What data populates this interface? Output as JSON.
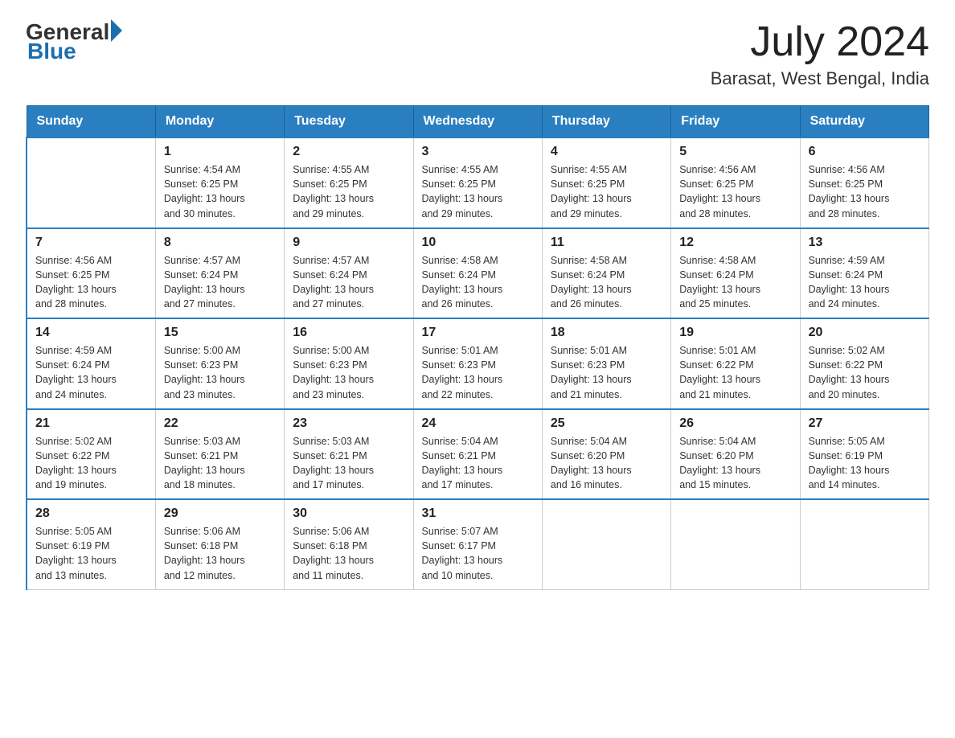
{
  "logo": {
    "general": "General",
    "blue": "Blue",
    "triangle": "▶"
  },
  "title": {
    "month_year": "July 2024",
    "location": "Barasat, West Bengal, India"
  },
  "weekdays": [
    "Sunday",
    "Monday",
    "Tuesday",
    "Wednesday",
    "Thursday",
    "Friday",
    "Saturday"
  ],
  "weeks": [
    [
      {
        "day": "",
        "info": ""
      },
      {
        "day": "1",
        "info": "Sunrise: 4:54 AM\nSunset: 6:25 PM\nDaylight: 13 hours\nand 30 minutes."
      },
      {
        "day": "2",
        "info": "Sunrise: 4:55 AM\nSunset: 6:25 PM\nDaylight: 13 hours\nand 29 minutes."
      },
      {
        "day": "3",
        "info": "Sunrise: 4:55 AM\nSunset: 6:25 PM\nDaylight: 13 hours\nand 29 minutes."
      },
      {
        "day": "4",
        "info": "Sunrise: 4:55 AM\nSunset: 6:25 PM\nDaylight: 13 hours\nand 29 minutes."
      },
      {
        "day": "5",
        "info": "Sunrise: 4:56 AM\nSunset: 6:25 PM\nDaylight: 13 hours\nand 28 minutes."
      },
      {
        "day": "6",
        "info": "Sunrise: 4:56 AM\nSunset: 6:25 PM\nDaylight: 13 hours\nand 28 minutes."
      }
    ],
    [
      {
        "day": "7",
        "info": "Sunrise: 4:56 AM\nSunset: 6:25 PM\nDaylight: 13 hours\nand 28 minutes."
      },
      {
        "day": "8",
        "info": "Sunrise: 4:57 AM\nSunset: 6:24 PM\nDaylight: 13 hours\nand 27 minutes."
      },
      {
        "day": "9",
        "info": "Sunrise: 4:57 AM\nSunset: 6:24 PM\nDaylight: 13 hours\nand 27 minutes."
      },
      {
        "day": "10",
        "info": "Sunrise: 4:58 AM\nSunset: 6:24 PM\nDaylight: 13 hours\nand 26 minutes."
      },
      {
        "day": "11",
        "info": "Sunrise: 4:58 AM\nSunset: 6:24 PM\nDaylight: 13 hours\nand 26 minutes."
      },
      {
        "day": "12",
        "info": "Sunrise: 4:58 AM\nSunset: 6:24 PM\nDaylight: 13 hours\nand 25 minutes."
      },
      {
        "day": "13",
        "info": "Sunrise: 4:59 AM\nSunset: 6:24 PM\nDaylight: 13 hours\nand 24 minutes."
      }
    ],
    [
      {
        "day": "14",
        "info": "Sunrise: 4:59 AM\nSunset: 6:24 PM\nDaylight: 13 hours\nand 24 minutes."
      },
      {
        "day": "15",
        "info": "Sunrise: 5:00 AM\nSunset: 6:23 PM\nDaylight: 13 hours\nand 23 minutes."
      },
      {
        "day": "16",
        "info": "Sunrise: 5:00 AM\nSunset: 6:23 PM\nDaylight: 13 hours\nand 23 minutes."
      },
      {
        "day": "17",
        "info": "Sunrise: 5:01 AM\nSunset: 6:23 PM\nDaylight: 13 hours\nand 22 minutes."
      },
      {
        "day": "18",
        "info": "Sunrise: 5:01 AM\nSunset: 6:23 PM\nDaylight: 13 hours\nand 21 minutes."
      },
      {
        "day": "19",
        "info": "Sunrise: 5:01 AM\nSunset: 6:22 PM\nDaylight: 13 hours\nand 21 minutes."
      },
      {
        "day": "20",
        "info": "Sunrise: 5:02 AM\nSunset: 6:22 PM\nDaylight: 13 hours\nand 20 minutes."
      }
    ],
    [
      {
        "day": "21",
        "info": "Sunrise: 5:02 AM\nSunset: 6:22 PM\nDaylight: 13 hours\nand 19 minutes."
      },
      {
        "day": "22",
        "info": "Sunrise: 5:03 AM\nSunset: 6:21 PM\nDaylight: 13 hours\nand 18 minutes."
      },
      {
        "day": "23",
        "info": "Sunrise: 5:03 AM\nSunset: 6:21 PM\nDaylight: 13 hours\nand 17 minutes."
      },
      {
        "day": "24",
        "info": "Sunrise: 5:04 AM\nSunset: 6:21 PM\nDaylight: 13 hours\nand 17 minutes."
      },
      {
        "day": "25",
        "info": "Sunrise: 5:04 AM\nSunset: 6:20 PM\nDaylight: 13 hours\nand 16 minutes."
      },
      {
        "day": "26",
        "info": "Sunrise: 5:04 AM\nSunset: 6:20 PM\nDaylight: 13 hours\nand 15 minutes."
      },
      {
        "day": "27",
        "info": "Sunrise: 5:05 AM\nSunset: 6:19 PM\nDaylight: 13 hours\nand 14 minutes."
      }
    ],
    [
      {
        "day": "28",
        "info": "Sunrise: 5:05 AM\nSunset: 6:19 PM\nDaylight: 13 hours\nand 13 minutes."
      },
      {
        "day": "29",
        "info": "Sunrise: 5:06 AM\nSunset: 6:18 PM\nDaylight: 13 hours\nand 12 minutes."
      },
      {
        "day": "30",
        "info": "Sunrise: 5:06 AM\nSunset: 6:18 PM\nDaylight: 13 hours\nand 11 minutes."
      },
      {
        "day": "31",
        "info": "Sunrise: 5:07 AM\nSunset: 6:17 PM\nDaylight: 13 hours\nand 10 minutes."
      },
      {
        "day": "",
        "info": ""
      },
      {
        "day": "",
        "info": ""
      },
      {
        "day": "",
        "info": ""
      }
    ]
  ]
}
